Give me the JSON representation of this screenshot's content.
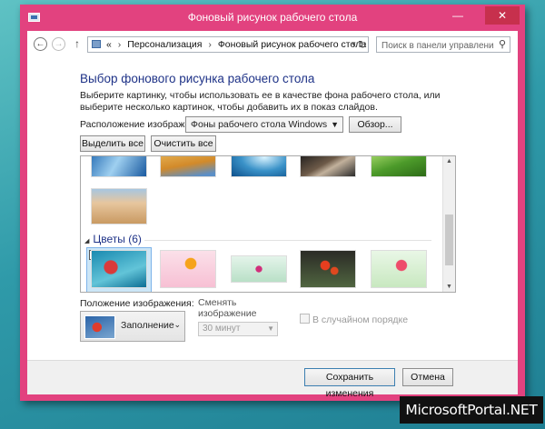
{
  "window": {
    "title": "Фоновый рисунок рабочего стола",
    "minimize": "—",
    "maximize": "❐",
    "close": "✕"
  },
  "address": {
    "back": "←",
    "forward": "→",
    "up": "↑",
    "overflow": "«",
    "crumbs": [
      "Персонализация",
      "Фоновый рисунок рабочего стола"
    ],
    "crumb_sep": "›",
    "dropdown": "▾",
    "refresh": "↻"
  },
  "search": {
    "placeholder": "Поиск в панели управления",
    "icon": "search-icon"
  },
  "main": {
    "heading": "Выбор фонового рисунка рабочего стола",
    "description": "Выберите картинку, чтобы использовать ее в качестве фона рабочего стола, или выберите несколько картинок, чтобы добавить их в показ слайдов.",
    "location_label": "Расположение изображения:",
    "location_value": "Фоны рабочего стола Windows",
    "browse_label": "Обзор...",
    "select_all_label": "Выделить все",
    "clear_all_label": "Очистить все"
  },
  "gallery": {
    "groups": [
      {
        "name": "Цветы (6)",
        "expanded": true
      }
    ],
    "selected_checkmark": "✓",
    "images_visible": 11
  },
  "options": {
    "position_label": "Положение изображения:",
    "position_value": "Заполнение",
    "interval_label": "Сменять изображение каждые:",
    "interval_value": "30 минут",
    "shuffle_label": "В случайном порядке",
    "shuffle_checked": false
  },
  "footer": {
    "save_label": "Сохранить изменения",
    "cancel_label": "Отмена"
  },
  "watermark": "MicrosoftPortal.NET",
  "colors": {
    "window_frame": "#e2427f",
    "heading": "#1e3287",
    "close_button": "#c7304d"
  }
}
